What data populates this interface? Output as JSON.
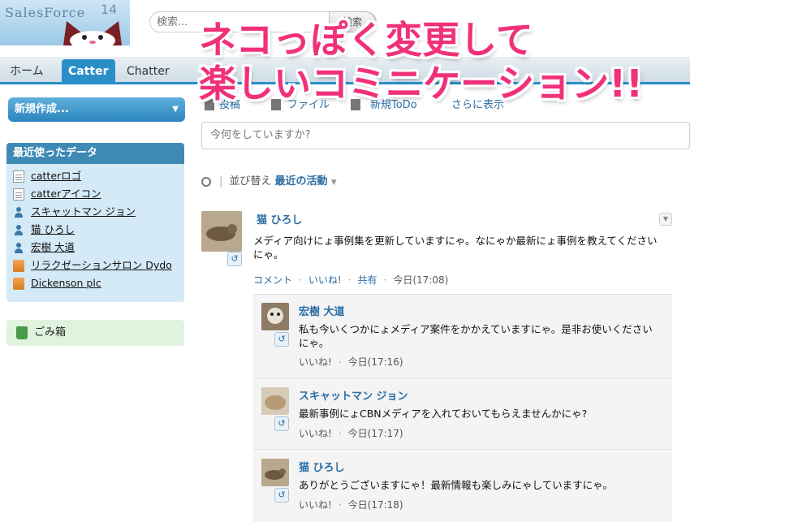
{
  "header": {
    "logo_text": "SalesForce",
    "logo_number": "14",
    "search_placeholder": "検索...",
    "search_button": "検索"
  },
  "tabs": [
    {
      "label": "ホーム",
      "active": false
    },
    {
      "label": "Catter",
      "active": true
    },
    {
      "label": "Chatter",
      "active": false
    }
  ],
  "sidebar": {
    "new_button": "新規作成...",
    "recent_title": "最近使ったデータ",
    "recent_items": [
      {
        "label": "catterロゴ",
        "icon": "document-icon"
      },
      {
        "label": "catterアイコン",
        "icon": "document-icon"
      },
      {
        "label": "スキャットマン ジョン",
        "icon": "person-icon"
      },
      {
        "label": "猫 ひろし",
        "icon": "person-icon"
      },
      {
        "label": "宏樹 大道",
        "icon": "person-icon"
      },
      {
        "label": "リラクゼーションサロン Dydo",
        "icon": "account-icon"
      },
      {
        "label": "Dickenson plc",
        "icon": "account-icon"
      }
    ],
    "trash_label": "ごみ箱"
  },
  "publisher": {
    "post_tab": "投稿",
    "file_tab": "ファイル",
    "new_tab": "新規ToDo",
    "more": "さらに表示",
    "input_placeholder": "今何をしていますか?"
  },
  "sort": {
    "label": "並び替え",
    "value": "最近の活動"
  },
  "post": {
    "author": "猫 ひろし",
    "body": "メディア向けにょ事例集を更新していますにゃ。なにゃか最新にょ事例を教えてくださいにゃ。",
    "actions": {
      "comment": "コメント",
      "like": "いいね!",
      "share": "共有",
      "time": "今日(17:08)"
    }
  },
  "comments": [
    {
      "author": "宏樹 大道",
      "body": "私も今いくつかにょメディア案件をかかえていますにゃ。是非お使いくださいにゃ。",
      "like": "いいね!",
      "time": "今日(17:16)"
    },
    {
      "author": "スキャットマン ジョン",
      "body": "最新事例にょCBNメディアを入れておいてもらえませんかにゃ?",
      "like": "いいね!",
      "time": "今日(17:17)"
    },
    {
      "author": "猫 ひろし",
      "body": "ありがとうございますにゃ！最新情報も楽しみにゃしていますにゃ。",
      "like": "いいね!",
      "time": "今日(17:18)"
    }
  ],
  "overlay": {
    "line1": "ネコっぽく変更して",
    "line2": "楽しいコミニケーション!!"
  },
  "colors": {
    "accent": "#2a8fc7",
    "link": "#2a6ea5",
    "overlay_text": "#f0317a"
  }
}
